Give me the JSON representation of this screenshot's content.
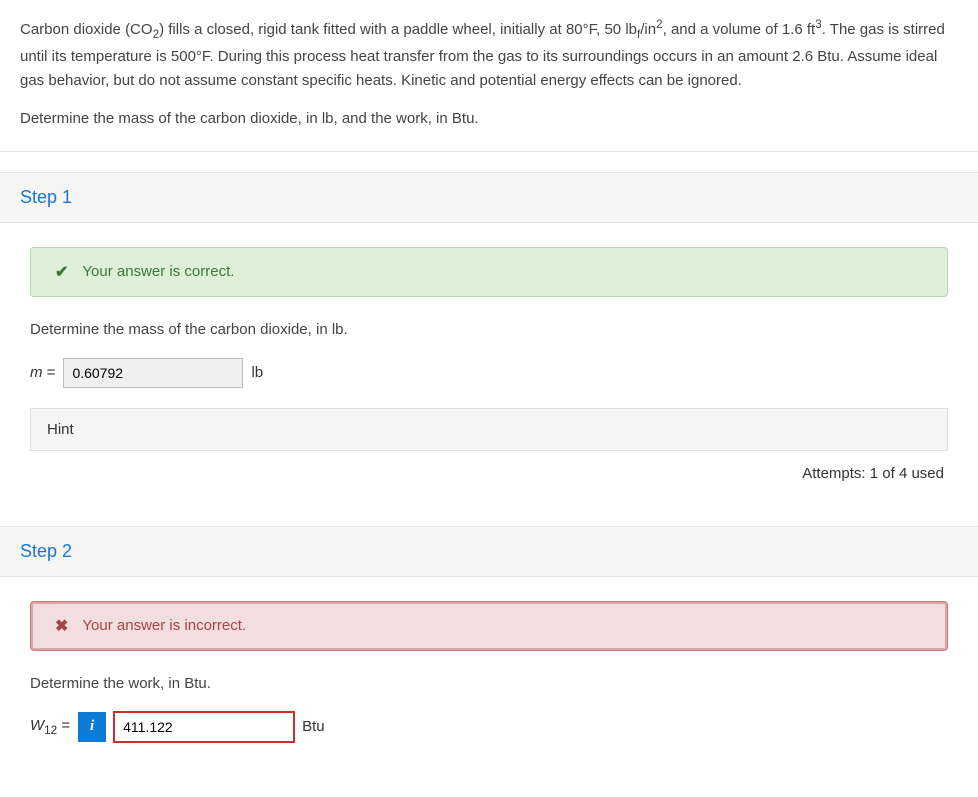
{
  "problem": {
    "p1_a": "Carbon dioxide (CO",
    "p1_b": ") fills a closed, rigid tank fitted with a paddle wheel, initially at 80°F, 50 lb",
    "p1_c": "/in",
    "p1_d": ", and a volume of 1.6 ft",
    "p1_e": ". The gas is stirred until its temperature is 500°F. During this process heat transfer from the gas to its surroundings occurs in an amount 2.6 Btu. Assume ideal gas behavior, but do not assume constant specific heats. Kinetic and potential energy effects can be ignored.",
    "sub_co2": "2",
    "sub_f": "f",
    "sup_2": "2",
    "sup_3": "3",
    "p2": "Determine the mass of the carbon dioxide, in lb, and the work, in Btu."
  },
  "step1": {
    "title": "Step 1",
    "feedback": "Your answer is correct.",
    "prompt": "Determine the mass of the carbon dioxide, in lb.",
    "var_label": "m",
    "equals": " = ",
    "value": "0.60792",
    "unit": "lb",
    "hint_label": "Hint",
    "attempts": "Attempts: 1 of 4 used"
  },
  "step2": {
    "title": "Step 2",
    "feedback": "Your answer is incorrect.",
    "prompt": "Determine the work, in Btu.",
    "var_label": "W",
    "var_sub": "12",
    "equals": " = ",
    "info_label": "i",
    "value": "411.122",
    "unit": "Btu"
  }
}
